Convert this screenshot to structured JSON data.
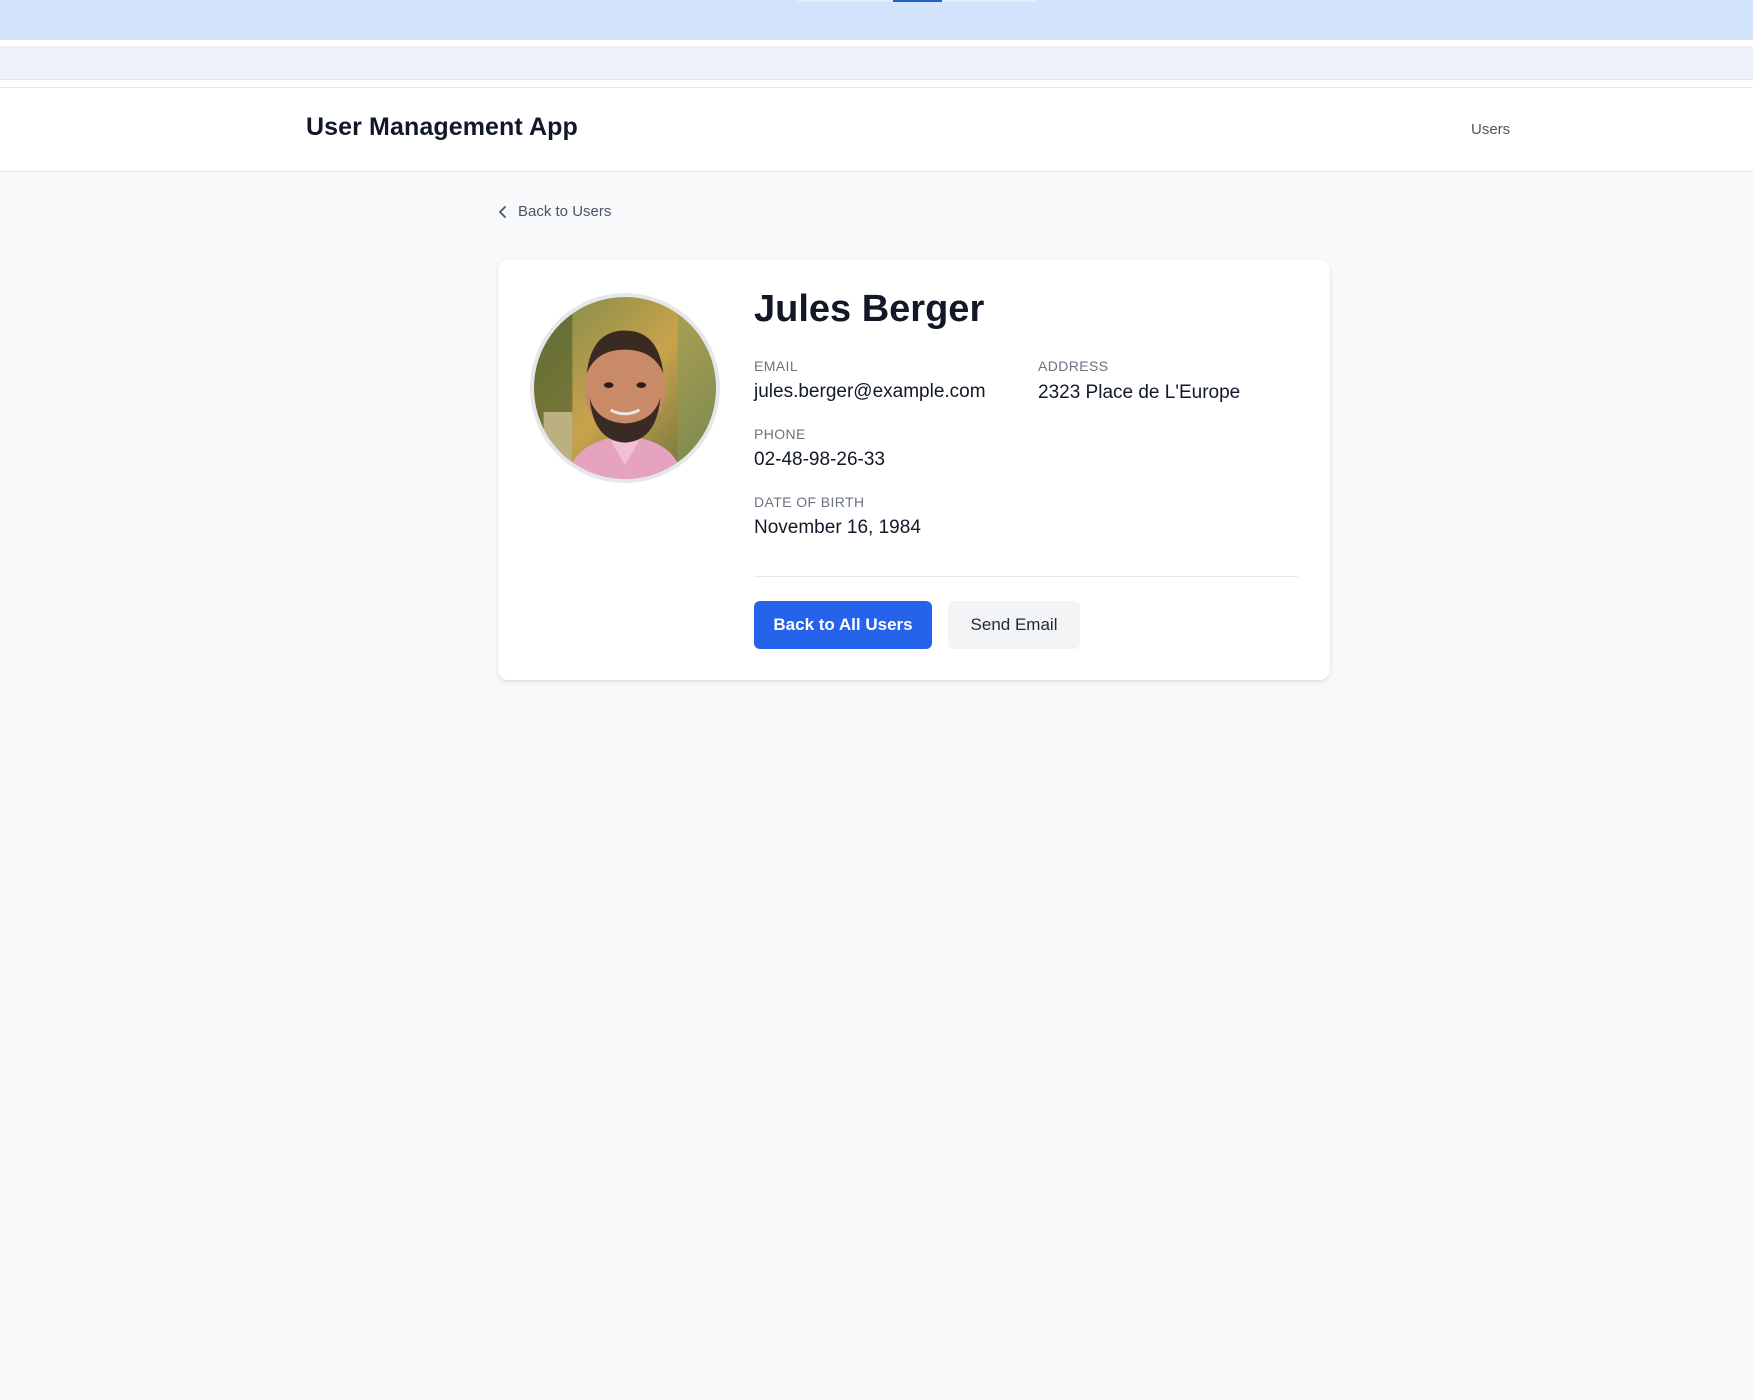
{
  "app": {
    "title": "User Management App",
    "nav_users": "Users"
  },
  "breadcrumb": {
    "back_label": "Back to Users"
  },
  "user": {
    "name": "Jules Berger",
    "email_label": "EMAIL",
    "email": "jules.berger@example.com",
    "address_label": "ADDRESS",
    "address": "2323 Place de L'Europe",
    "phone_label": "PHONE",
    "phone": "02-48-98-26-33",
    "dob_label": "DATE OF BIRTH",
    "dob": "November 16, 1984"
  },
  "actions": {
    "back_all_label": "Back to All Users",
    "send_email_label": "Send Email"
  },
  "icons": {
    "back": "chevron-left-icon",
    "avatar": "user-photo"
  },
  "colors": {
    "primary": "#2563eb",
    "page_bg": "#f8f9fb",
    "top_band": "#d3e3fb"
  }
}
